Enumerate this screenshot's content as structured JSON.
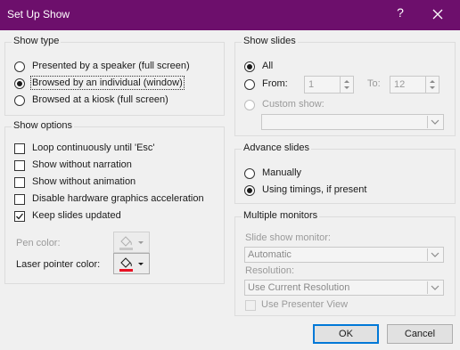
{
  "window": {
    "title": "Set Up Show",
    "help_glyph": "?",
    "close_icon": "close-icon"
  },
  "show_type": {
    "legend": "Show type",
    "options": [
      {
        "label": "Presented by a speaker (full screen)",
        "selected": false
      },
      {
        "label": "Browsed by an individual (window)",
        "selected": true
      },
      {
        "label": "Browsed at a kiosk (full screen)",
        "selected": false
      }
    ]
  },
  "show_options": {
    "legend": "Show options",
    "checkboxes": [
      {
        "label": "Loop continuously until 'Esc'",
        "checked": false,
        "enabled": true
      },
      {
        "label": "Show without narration",
        "checked": false,
        "enabled": true
      },
      {
        "label": "Show without animation",
        "checked": false,
        "enabled": true
      },
      {
        "label": "Disable hardware graphics acceleration",
        "checked": false,
        "enabled": true
      },
      {
        "label": "Keep slides updated",
        "checked": true,
        "enabled": true
      }
    ],
    "pen_color": {
      "label": "Pen color:",
      "enabled": false,
      "swatch": "#c8c8c8"
    },
    "laser_color": {
      "label": "Laser pointer color:",
      "enabled": true,
      "swatch": "#e81123"
    }
  },
  "show_slides": {
    "legend": "Show slides",
    "all_label": "All",
    "from_label": "From:",
    "from_value": "1",
    "to_label": "To:",
    "to_value": "12",
    "custom_label": "Custom show:",
    "custom_value": ""
  },
  "advance_slides": {
    "legend": "Advance slides",
    "manually_label": "Manually",
    "timings_label": "Using timings, if present"
  },
  "monitors": {
    "legend": "Multiple monitors",
    "monitor_label": "Slide show monitor:",
    "monitor_value": "Automatic",
    "resolution_label": "Resolution:",
    "resolution_value": "Use Current Resolution",
    "presenter_label": "Use Presenter View"
  },
  "buttons": {
    "ok": "OK",
    "cancel": "Cancel"
  },
  "colors": {
    "titlebar": "#6d0f6c",
    "accent": "#0078d7",
    "dialog_bg": "#f0f0f0"
  }
}
